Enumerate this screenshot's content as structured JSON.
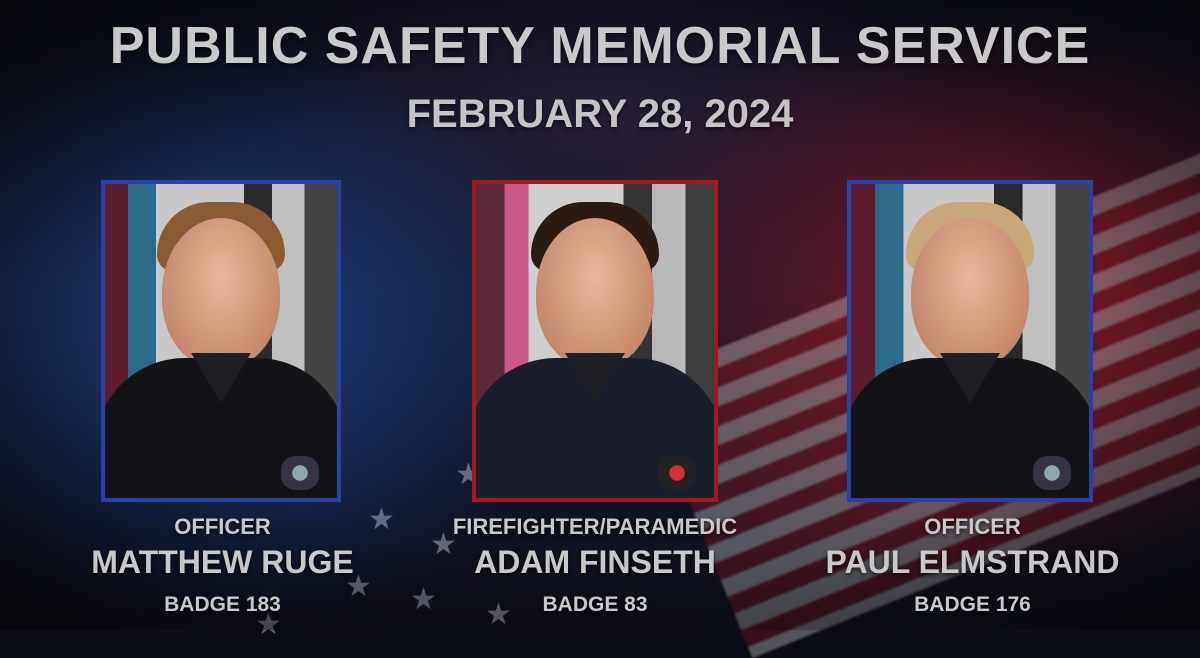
{
  "header": {
    "title": "PUBLIC SAFETY MEMORIAL SERVICE",
    "date": "FEBRUARY 28, 2024"
  },
  "honorees": [
    {
      "role": "OFFICER",
      "name": "MATTHEW RUGE",
      "badge": "BADGE 183",
      "frame_color": "#2a3fa8"
    },
    {
      "role": "FIREFIGHTER/PARAMEDIC",
      "name": "ADAM FINSETH",
      "badge": "BADGE 83",
      "frame_color": "#a01822"
    },
    {
      "role": "OFFICER",
      "name": "PAUL ELMSTRAND",
      "badge": "BADGE 176",
      "frame_color": "#2a3fa8"
    }
  ]
}
